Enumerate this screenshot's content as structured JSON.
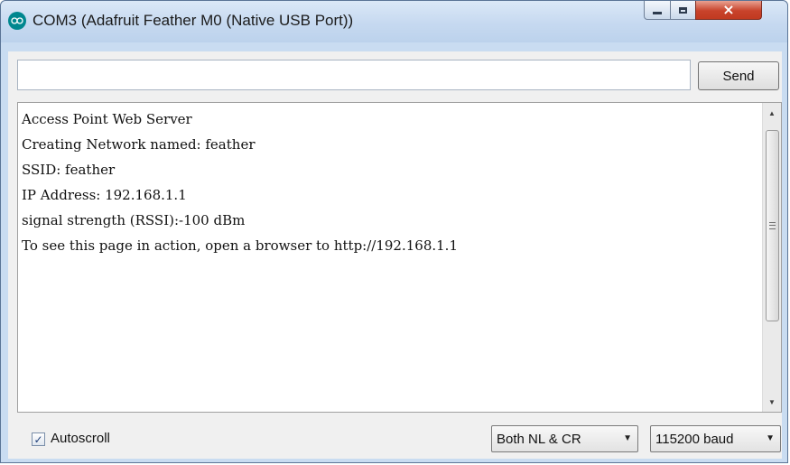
{
  "window": {
    "title": "COM3 (Adafruit Feather M0 (Native USB Port))",
    "icon": "arduino-icon",
    "controls": {
      "minimize": "minimize-icon",
      "maximize": "maximize-icon",
      "close": "×"
    }
  },
  "input_row": {
    "input_value": "",
    "input_placeholder": "",
    "send_label": "Send"
  },
  "output": {
    "lines": [
      "Access Point Web Server",
      "Creating Network named: feather",
      "SSID: feather",
      "IP Address: 192.168.1.1",
      "signal strength (RSSI):-100 dBm",
      "To see this page in action, open a browser to http://192.168.1.1"
    ]
  },
  "status": {
    "autoscroll_label": "Autoscroll",
    "autoscroll_checked": true,
    "check_glyph": "✓",
    "line_ending": "Both NL & CR",
    "baud_rate": "115200 baud",
    "dropdown_arrow": "▼"
  },
  "colors": {
    "titlebar": "#c6d9f0",
    "close_button": "#c8432b",
    "arduino_teal": "#00878f"
  }
}
